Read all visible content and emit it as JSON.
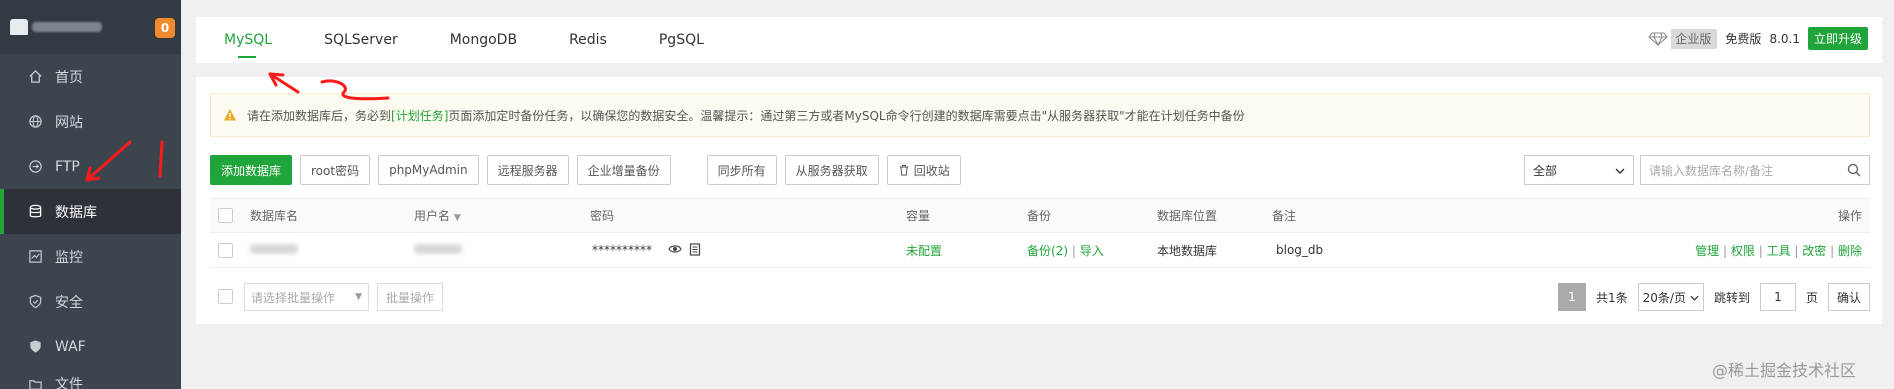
{
  "sidebar": {
    "badge": "0",
    "items": [
      {
        "label": "首页",
        "icon": "home-icon"
      },
      {
        "label": "网站",
        "icon": "globe-icon"
      },
      {
        "label": "FTP",
        "icon": "ftp-icon"
      },
      {
        "label": "数据库",
        "icon": "database-icon"
      },
      {
        "label": "监控",
        "icon": "monitor-icon"
      },
      {
        "label": "安全",
        "icon": "shield-icon"
      },
      {
        "label": "WAF",
        "icon": "waf-shield-icon"
      },
      {
        "label": "文件",
        "icon": "folder-icon"
      }
    ]
  },
  "tabs": [
    "MySQL",
    "SQLServer",
    "MongoDB",
    "Redis",
    "PgSQL"
  ],
  "topright": {
    "enterprise": "企业版",
    "free": "免费版",
    "version": "8.0.1",
    "upgrade": "立即升级"
  },
  "notice": {
    "before": "请在添加数据库后，务必到",
    "link": "[计划任务]",
    "after": "页面添加定时备份任务，以确保您的数据安全。温馨提示：通过第三方或者MySQL命令行创建的数据库需要点击\"从服务器获取\"才能在计划任务中备份"
  },
  "toolbar": {
    "add": "添加数据库",
    "root": "root密码",
    "pma": "phpMyAdmin",
    "remote": "远程服务器",
    "backup": "企业增量备份",
    "sync": "同步所有",
    "fetch": "从服务器获取",
    "recycle": "回收站",
    "filter": "全部",
    "search_placeholder": "请输入数据库名称/备注"
  },
  "table": {
    "headers": {
      "name": "数据库名",
      "user": "用户名",
      "password": "密码",
      "capacity": "容量",
      "backup": "备份",
      "location": "数据库位置",
      "remark": "备注",
      "actions": "操作"
    },
    "rows": [
      {
        "password": "**********",
        "capacity": "未配置",
        "backup": "备份(2)",
        "import": "导入",
        "location": "本地数据库",
        "remark": "blog_db",
        "actions": [
          "管理",
          "权限",
          "工具",
          "改密",
          "删除"
        ]
      }
    ]
  },
  "footer": {
    "batch_placeholder": "请选择批量操作",
    "batch_btn": "批量操作",
    "page": "1",
    "total": "共1条",
    "page_size": "20条/页",
    "jump": "跳转到",
    "jump_value": "1",
    "page_unit": "页",
    "confirm": "确认"
  },
  "watermark": "@稀土掘金技术社区",
  "colors": {
    "accent": "#20a53a",
    "annotation": "#ff0000",
    "sidebar": "#3c444d"
  }
}
